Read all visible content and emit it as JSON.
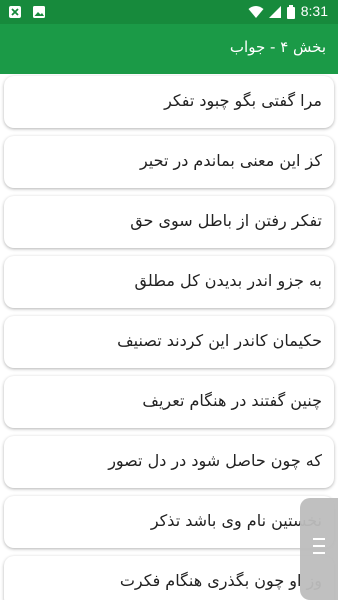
{
  "status_bar": {
    "time": "8:31",
    "icons": [
      "notification-x-icon",
      "image-icon",
      "wifi-icon",
      "signal-icon",
      "battery-icon"
    ]
  },
  "app_bar": {
    "title": "بخش ۴ - جواب"
  },
  "verses": [
    "مرا گفتی بگو چبود تفکر",
    "کز این معنی بماندم در تحیر",
    "تفکر رفتن از باطل سوی حق",
    "به جزو اندر بدیدن کل مطلق",
    "حکیمان کاندر این کردند تصنیف",
    "چنین گفتند در هنگام تعریف",
    "که چون حاصل شود در دل تصور",
    "نخستین نام وی باشد تذکر",
    "وز او چون بگذری هنگام فکرت"
  ],
  "colors": {
    "status_bar": "#178a3c",
    "app_bar": "#1b9a47",
    "card_background": "#ffffff",
    "text": "#222222",
    "scroll_thumb": "#bdbdbd"
  }
}
